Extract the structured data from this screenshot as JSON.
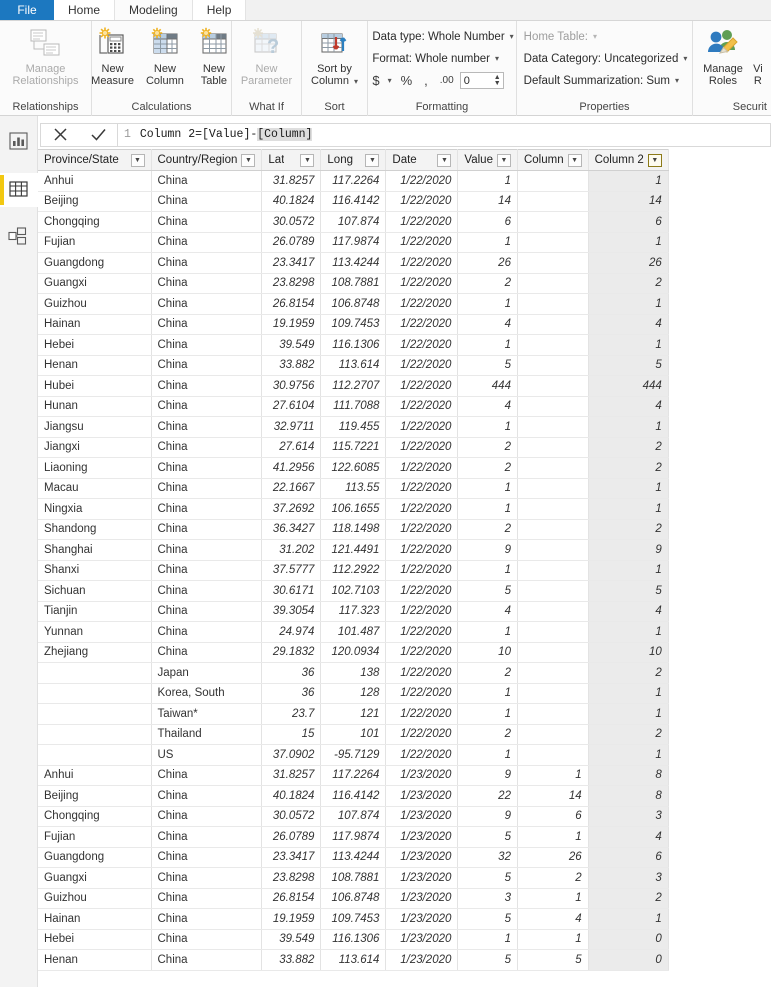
{
  "tabs": [
    {
      "label": "File",
      "kind": "file"
    },
    {
      "label": "Home",
      "kind": "normal"
    },
    {
      "label": "Modeling",
      "kind": "active"
    },
    {
      "label": "Help",
      "kind": "normal"
    }
  ],
  "ribbon": {
    "groups": [
      {
        "title": "Relationships",
        "buttons": [
          {
            "label_line1": "Manage",
            "label_line2": "Relationships",
            "icon": "manage-relationships-icon",
            "disabled": true
          }
        ]
      },
      {
        "title": "Calculations",
        "buttons": [
          {
            "label_line1": "New",
            "label_line2": "Measure",
            "icon": "new-measure-icon",
            "disabled": false
          },
          {
            "label_line1": "New",
            "label_line2": "Column",
            "icon": "new-column-icon",
            "disabled": false
          },
          {
            "label_line1": "New",
            "label_line2": "Table",
            "icon": "new-table-icon",
            "disabled": false
          }
        ]
      },
      {
        "title": "What If",
        "buttons": [
          {
            "label_line1": "New",
            "label_line2": "Parameter",
            "icon": "new-parameter-icon",
            "disabled": true
          }
        ]
      },
      {
        "title": "Sort",
        "buttons": [
          {
            "label_line1": "Sort by",
            "label_line2": "Column",
            "icon": "sort-by-column-icon",
            "disabled": false,
            "has_caret": true
          }
        ]
      },
      {
        "title": "Formatting",
        "rows": [
          {
            "text": "Data type: Whole Number",
            "caret": true,
            "dim": false
          },
          {
            "text": "Format: Whole number",
            "caret": true,
            "dim": false
          }
        ],
        "format_row": {
          "currency_symbol": "$",
          "percent_symbol": "%",
          "thousands_symbol": ",",
          "decimal_symbol": ".00",
          "decimal_value": "0"
        }
      },
      {
        "title": "Properties",
        "rows": [
          {
            "text": "Home Table:",
            "caret": true,
            "dim": true
          },
          {
            "text": "Data Category: Uncategorized",
            "caret": true,
            "dim": false
          },
          {
            "text": "Default Summarization: Sum",
            "caret": true,
            "dim": false
          }
        ]
      },
      {
        "title": "Securit",
        "buttons": [
          {
            "label_line1": "Manage",
            "label_line2": "Roles",
            "icon": "manage-roles-icon",
            "disabled": false
          },
          {
            "label_line1": "Vi",
            "label_line2": "R",
            "icon": "view-as-roles-icon",
            "disabled": false
          }
        ]
      }
    ]
  },
  "leftnav": {
    "items": [
      {
        "icon": "report-view-icon",
        "name": "report-view",
        "active": false
      },
      {
        "icon": "data-view-icon",
        "name": "data-view",
        "active": true
      },
      {
        "icon": "model-view-icon",
        "name": "model-view",
        "active": false
      }
    ]
  },
  "formula_bar": {
    "cancel_icon": "close-icon",
    "accept_icon": "check-icon",
    "line_number": "1",
    "measure_name": "Column 2",
    "equals": " = ",
    "expr_left": "[Value]",
    "operator": "-",
    "expr_right": "[Column]"
  },
  "grid": {
    "columns": [
      {
        "label": "Province/State",
        "cls": "col-ps",
        "align": "txt",
        "selected": false
      },
      {
        "label": "Country/Region",
        "cls": "col-cr",
        "align": "txt",
        "selected": false
      },
      {
        "label": "Lat",
        "cls": "col-lat",
        "align": "num",
        "selected": false
      },
      {
        "label": "Long",
        "cls": "col-long",
        "align": "num",
        "selected": false
      },
      {
        "label": "Date",
        "cls": "col-date",
        "align": "num",
        "selected": false
      },
      {
        "label": "Value",
        "cls": "col-val",
        "align": "num",
        "selected": false
      },
      {
        "label": "Column",
        "cls": "col-c1",
        "align": "num",
        "selected": false
      },
      {
        "label": "Column 2",
        "cls": "col-c2",
        "align": "num",
        "selected": true
      }
    ],
    "rows": [
      [
        "Anhui",
        "China",
        "31.8257",
        "117.2264",
        "1/22/2020",
        "1",
        "",
        "1"
      ],
      [
        "Beijing",
        "China",
        "40.1824",
        "116.4142",
        "1/22/2020",
        "14",
        "",
        "14"
      ],
      [
        "Chongqing",
        "China",
        "30.0572",
        "107.874",
        "1/22/2020",
        "6",
        "",
        "6"
      ],
      [
        "Fujian",
        "China",
        "26.0789",
        "117.9874",
        "1/22/2020",
        "1",
        "",
        "1"
      ],
      [
        "Guangdong",
        "China",
        "23.3417",
        "113.4244",
        "1/22/2020",
        "26",
        "",
        "26"
      ],
      [
        "Guangxi",
        "China",
        "23.8298",
        "108.7881",
        "1/22/2020",
        "2",
        "",
        "2"
      ],
      [
        "Guizhou",
        "China",
        "26.8154",
        "106.8748",
        "1/22/2020",
        "1",
        "",
        "1"
      ],
      [
        "Hainan",
        "China",
        "19.1959",
        "109.7453",
        "1/22/2020",
        "4",
        "",
        "4"
      ],
      [
        "Hebei",
        "China",
        "39.549",
        "116.1306",
        "1/22/2020",
        "1",
        "",
        "1"
      ],
      [
        "Henan",
        "China",
        "33.882",
        "113.614",
        "1/22/2020",
        "5",
        "",
        "5"
      ],
      [
        "Hubei",
        "China",
        "30.9756",
        "112.2707",
        "1/22/2020",
        "444",
        "",
        "444"
      ],
      [
        "Hunan",
        "China",
        "27.6104",
        "111.7088",
        "1/22/2020",
        "4",
        "",
        "4"
      ],
      [
        "Jiangsu",
        "China",
        "32.9711",
        "119.455",
        "1/22/2020",
        "1",
        "",
        "1"
      ],
      [
        "Jiangxi",
        "China",
        "27.614",
        "115.7221",
        "1/22/2020",
        "2",
        "",
        "2"
      ],
      [
        "Liaoning",
        "China",
        "41.2956",
        "122.6085",
        "1/22/2020",
        "2",
        "",
        "2"
      ],
      [
        "Macau",
        "China",
        "22.1667",
        "113.55",
        "1/22/2020",
        "1",
        "",
        "1"
      ],
      [
        "Ningxia",
        "China",
        "37.2692",
        "106.1655",
        "1/22/2020",
        "1",
        "",
        "1"
      ],
      [
        "Shandong",
        "China",
        "36.3427",
        "118.1498",
        "1/22/2020",
        "2",
        "",
        "2"
      ],
      [
        "Shanghai",
        "China",
        "31.202",
        "121.4491",
        "1/22/2020",
        "9",
        "",
        "9"
      ],
      [
        "Shanxi",
        "China",
        "37.5777",
        "112.2922",
        "1/22/2020",
        "1",
        "",
        "1"
      ],
      [
        "Sichuan",
        "China",
        "30.6171",
        "102.7103",
        "1/22/2020",
        "5",
        "",
        "5"
      ],
      [
        "Tianjin",
        "China",
        "39.3054",
        "117.323",
        "1/22/2020",
        "4",
        "",
        "4"
      ],
      [
        "Yunnan",
        "China",
        "24.974",
        "101.487",
        "1/22/2020",
        "1",
        "",
        "1"
      ],
      [
        "Zhejiang",
        "China",
        "29.1832",
        "120.0934",
        "1/22/2020",
        "10",
        "",
        "10"
      ],
      [
        "",
        "Japan",
        "36",
        "138",
        "1/22/2020",
        "2",
        "",
        "2"
      ],
      [
        "",
        "Korea, South",
        "36",
        "128",
        "1/22/2020",
        "1",
        "",
        "1"
      ],
      [
        "",
        "Taiwan*",
        "23.7",
        "121",
        "1/22/2020",
        "1",
        "",
        "1"
      ],
      [
        "",
        "Thailand",
        "15",
        "101",
        "1/22/2020",
        "2",
        "",
        "2"
      ],
      [
        "",
        "US",
        "37.0902",
        "-95.7129",
        "1/22/2020",
        "1",
        "",
        "1"
      ],
      [
        "Anhui",
        "China",
        "31.8257",
        "117.2264",
        "1/23/2020",
        "9",
        "1",
        "8"
      ],
      [
        "Beijing",
        "China",
        "40.1824",
        "116.4142",
        "1/23/2020",
        "22",
        "14",
        "8"
      ],
      [
        "Chongqing",
        "China",
        "30.0572",
        "107.874",
        "1/23/2020",
        "9",
        "6",
        "3"
      ],
      [
        "Fujian",
        "China",
        "26.0789",
        "117.9874",
        "1/23/2020",
        "5",
        "1",
        "4"
      ],
      [
        "Guangdong",
        "China",
        "23.3417",
        "113.4244",
        "1/23/2020",
        "32",
        "26",
        "6"
      ],
      [
        "Guangxi",
        "China",
        "23.8298",
        "108.7881",
        "1/23/2020",
        "5",
        "2",
        "3"
      ],
      [
        "Guizhou",
        "China",
        "26.8154",
        "106.8748",
        "1/23/2020",
        "3",
        "1",
        "2"
      ],
      [
        "Hainan",
        "China",
        "19.1959",
        "109.7453",
        "1/23/2020",
        "5",
        "4",
        "1"
      ],
      [
        "Hebei",
        "China",
        "39.549",
        "116.1306",
        "1/23/2020",
        "1",
        "1",
        "0"
      ],
      [
        "Henan",
        "China",
        "33.882",
        "113.614",
        "1/23/2020",
        "5",
        "5",
        "0"
      ]
    ]
  },
  "colors": {
    "file_tab": "#1c78c0",
    "selected_column_header": "#e8c020",
    "active_nav_accent": "#f2c811",
    "selected_column_cell": "#ebebeb"
  }
}
